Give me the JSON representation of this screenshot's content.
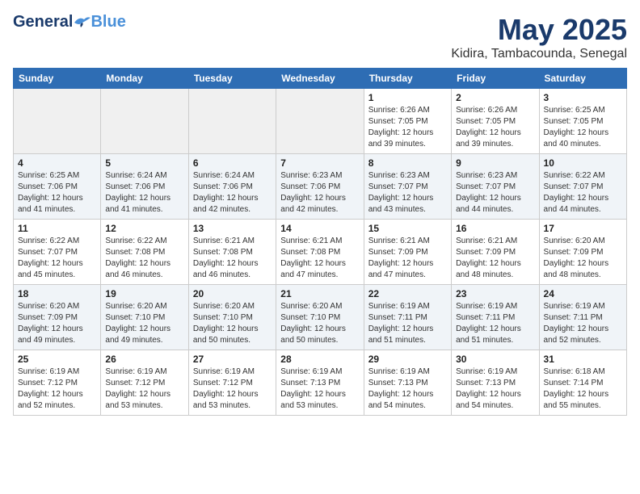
{
  "header": {
    "logo_general": "General",
    "logo_blue": "Blue",
    "month_title": "May 2025",
    "location": "Kidira, Tambacounda, Senegal"
  },
  "weekdays": [
    "Sunday",
    "Monday",
    "Tuesday",
    "Wednesday",
    "Thursday",
    "Friday",
    "Saturday"
  ],
  "weeks": [
    [
      {
        "day": "",
        "info": ""
      },
      {
        "day": "",
        "info": ""
      },
      {
        "day": "",
        "info": ""
      },
      {
        "day": "",
        "info": ""
      },
      {
        "day": "1",
        "info": "Sunrise: 6:26 AM\nSunset: 7:05 PM\nDaylight: 12 hours\nand 39 minutes."
      },
      {
        "day": "2",
        "info": "Sunrise: 6:26 AM\nSunset: 7:05 PM\nDaylight: 12 hours\nand 39 minutes."
      },
      {
        "day": "3",
        "info": "Sunrise: 6:25 AM\nSunset: 7:05 PM\nDaylight: 12 hours\nand 40 minutes."
      }
    ],
    [
      {
        "day": "4",
        "info": "Sunrise: 6:25 AM\nSunset: 7:06 PM\nDaylight: 12 hours\nand 41 minutes."
      },
      {
        "day": "5",
        "info": "Sunrise: 6:24 AM\nSunset: 7:06 PM\nDaylight: 12 hours\nand 41 minutes."
      },
      {
        "day": "6",
        "info": "Sunrise: 6:24 AM\nSunset: 7:06 PM\nDaylight: 12 hours\nand 42 minutes."
      },
      {
        "day": "7",
        "info": "Sunrise: 6:23 AM\nSunset: 7:06 PM\nDaylight: 12 hours\nand 42 minutes."
      },
      {
        "day": "8",
        "info": "Sunrise: 6:23 AM\nSunset: 7:07 PM\nDaylight: 12 hours\nand 43 minutes."
      },
      {
        "day": "9",
        "info": "Sunrise: 6:23 AM\nSunset: 7:07 PM\nDaylight: 12 hours\nand 44 minutes."
      },
      {
        "day": "10",
        "info": "Sunrise: 6:22 AM\nSunset: 7:07 PM\nDaylight: 12 hours\nand 44 minutes."
      }
    ],
    [
      {
        "day": "11",
        "info": "Sunrise: 6:22 AM\nSunset: 7:07 PM\nDaylight: 12 hours\nand 45 minutes."
      },
      {
        "day": "12",
        "info": "Sunrise: 6:22 AM\nSunset: 7:08 PM\nDaylight: 12 hours\nand 46 minutes."
      },
      {
        "day": "13",
        "info": "Sunrise: 6:21 AM\nSunset: 7:08 PM\nDaylight: 12 hours\nand 46 minutes."
      },
      {
        "day": "14",
        "info": "Sunrise: 6:21 AM\nSunset: 7:08 PM\nDaylight: 12 hours\nand 47 minutes."
      },
      {
        "day": "15",
        "info": "Sunrise: 6:21 AM\nSunset: 7:09 PM\nDaylight: 12 hours\nand 47 minutes."
      },
      {
        "day": "16",
        "info": "Sunrise: 6:21 AM\nSunset: 7:09 PM\nDaylight: 12 hours\nand 48 minutes."
      },
      {
        "day": "17",
        "info": "Sunrise: 6:20 AM\nSunset: 7:09 PM\nDaylight: 12 hours\nand 48 minutes."
      }
    ],
    [
      {
        "day": "18",
        "info": "Sunrise: 6:20 AM\nSunset: 7:09 PM\nDaylight: 12 hours\nand 49 minutes."
      },
      {
        "day": "19",
        "info": "Sunrise: 6:20 AM\nSunset: 7:10 PM\nDaylight: 12 hours\nand 49 minutes."
      },
      {
        "day": "20",
        "info": "Sunrise: 6:20 AM\nSunset: 7:10 PM\nDaylight: 12 hours\nand 50 minutes."
      },
      {
        "day": "21",
        "info": "Sunrise: 6:20 AM\nSunset: 7:10 PM\nDaylight: 12 hours\nand 50 minutes."
      },
      {
        "day": "22",
        "info": "Sunrise: 6:19 AM\nSunset: 7:11 PM\nDaylight: 12 hours\nand 51 minutes."
      },
      {
        "day": "23",
        "info": "Sunrise: 6:19 AM\nSunset: 7:11 PM\nDaylight: 12 hours\nand 51 minutes."
      },
      {
        "day": "24",
        "info": "Sunrise: 6:19 AM\nSunset: 7:11 PM\nDaylight: 12 hours\nand 52 minutes."
      }
    ],
    [
      {
        "day": "25",
        "info": "Sunrise: 6:19 AM\nSunset: 7:12 PM\nDaylight: 12 hours\nand 52 minutes."
      },
      {
        "day": "26",
        "info": "Sunrise: 6:19 AM\nSunset: 7:12 PM\nDaylight: 12 hours\nand 53 minutes."
      },
      {
        "day": "27",
        "info": "Sunrise: 6:19 AM\nSunset: 7:12 PM\nDaylight: 12 hours\nand 53 minutes."
      },
      {
        "day": "28",
        "info": "Sunrise: 6:19 AM\nSunset: 7:13 PM\nDaylight: 12 hours\nand 53 minutes."
      },
      {
        "day": "29",
        "info": "Sunrise: 6:19 AM\nSunset: 7:13 PM\nDaylight: 12 hours\nand 54 minutes."
      },
      {
        "day": "30",
        "info": "Sunrise: 6:19 AM\nSunset: 7:13 PM\nDaylight: 12 hours\nand 54 minutes."
      },
      {
        "day": "31",
        "info": "Sunrise: 6:18 AM\nSunset: 7:14 PM\nDaylight: 12 hours\nand 55 minutes."
      }
    ]
  ]
}
